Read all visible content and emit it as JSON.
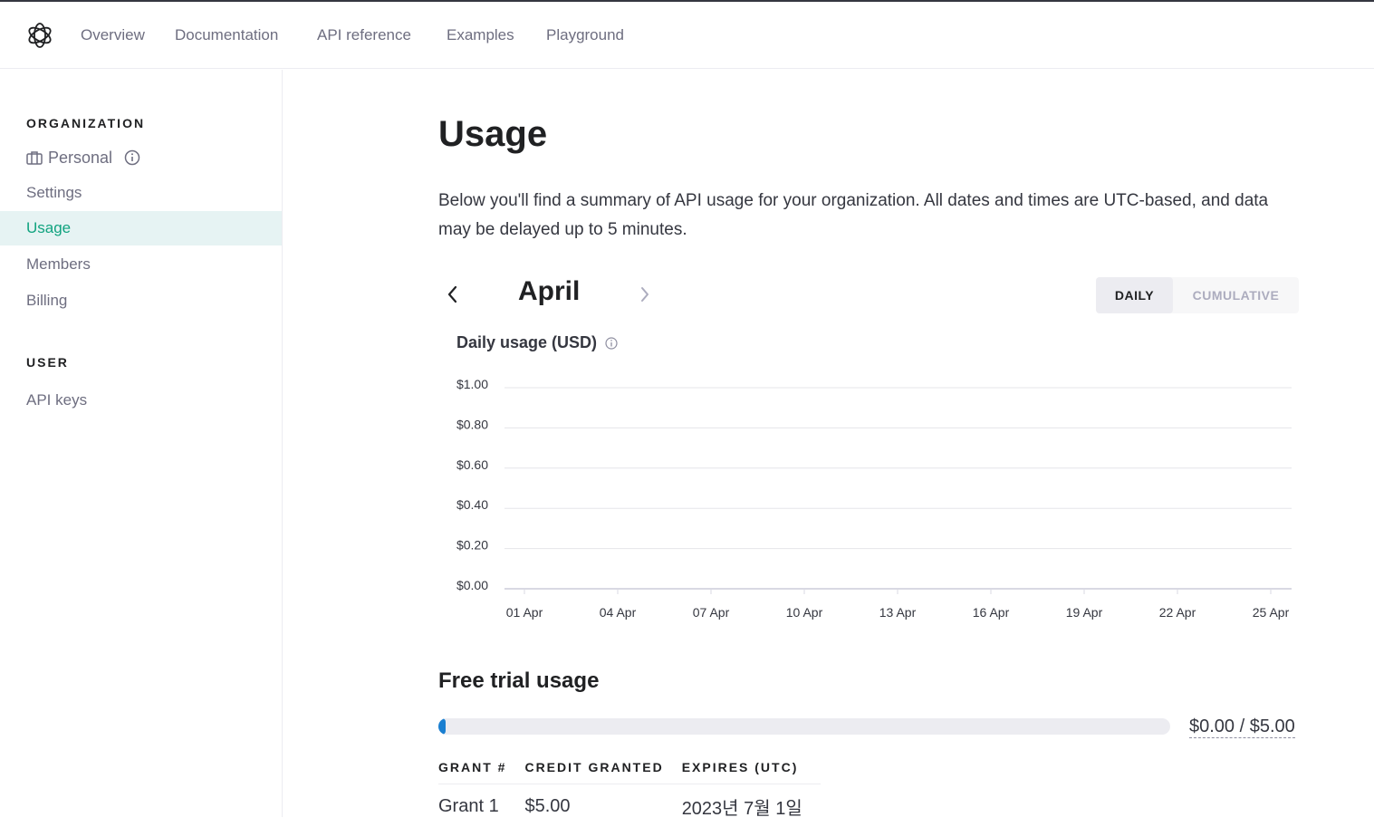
{
  "topnav": {
    "logo_icon": "openai-logo-icon",
    "links": [
      "Overview",
      "Documentation",
      "API reference",
      "Examples",
      "Playground"
    ]
  },
  "sidebar": {
    "org_heading": "ORGANIZATION",
    "org_name": "Personal",
    "org_icon": "briefcase-icon",
    "items": [
      "Settings",
      "Usage",
      "Members",
      "Billing"
    ],
    "active_item": "Usage",
    "user_heading": "USER",
    "user_items": [
      "API keys"
    ]
  },
  "page": {
    "title": "Usage",
    "description": "Below you'll find a summary of API usage for your organization. All dates and times are UTC-based, and data may be delayed up to 5 minutes.",
    "month": "April",
    "toggle": {
      "daily": "DAILY",
      "cumulative": "CUMULATIVE",
      "selected": "DAILY"
    },
    "chart_title": "Daily usage (USD)"
  },
  "chart_data": {
    "type": "bar",
    "title": "Daily usage (USD)",
    "yticks": [
      "$1.00",
      "$0.80",
      "$0.60",
      "$0.40",
      "$0.20",
      "$0.00"
    ],
    "xticks": [
      "01 Apr",
      "04 Apr",
      "07 Apr",
      "10 Apr",
      "13 Apr",
      "16 Apr",
      "19 Apr",
      "22 Apr",
      "25 Apr"
    ],
    "ylim": [
      0,
      1
    ],
    "values": [],
    "grid": true
  },
  "free_trial": {
    "title": "Free trial usage",
    "used": "$0.00",
    "total": "$5.00",
    "amount_text": "$0.00 / $5.00",
    "progress_fraction": 0.0,
    "table_headers": [
      "GRANT #",
      "CREDIT GRANTED",
      "EXPIRES (UTC)"
    ],
    "rows": [
      [
        "Grant 1",
        "$5.00",
        "2023년 7월 1일"
      ]
    ]
  },
  "colors": {
    "accent": "#10a37f",
    "active_bg": "#e6f3f3",
    "progress": "#1a7fd1"
  }
}
